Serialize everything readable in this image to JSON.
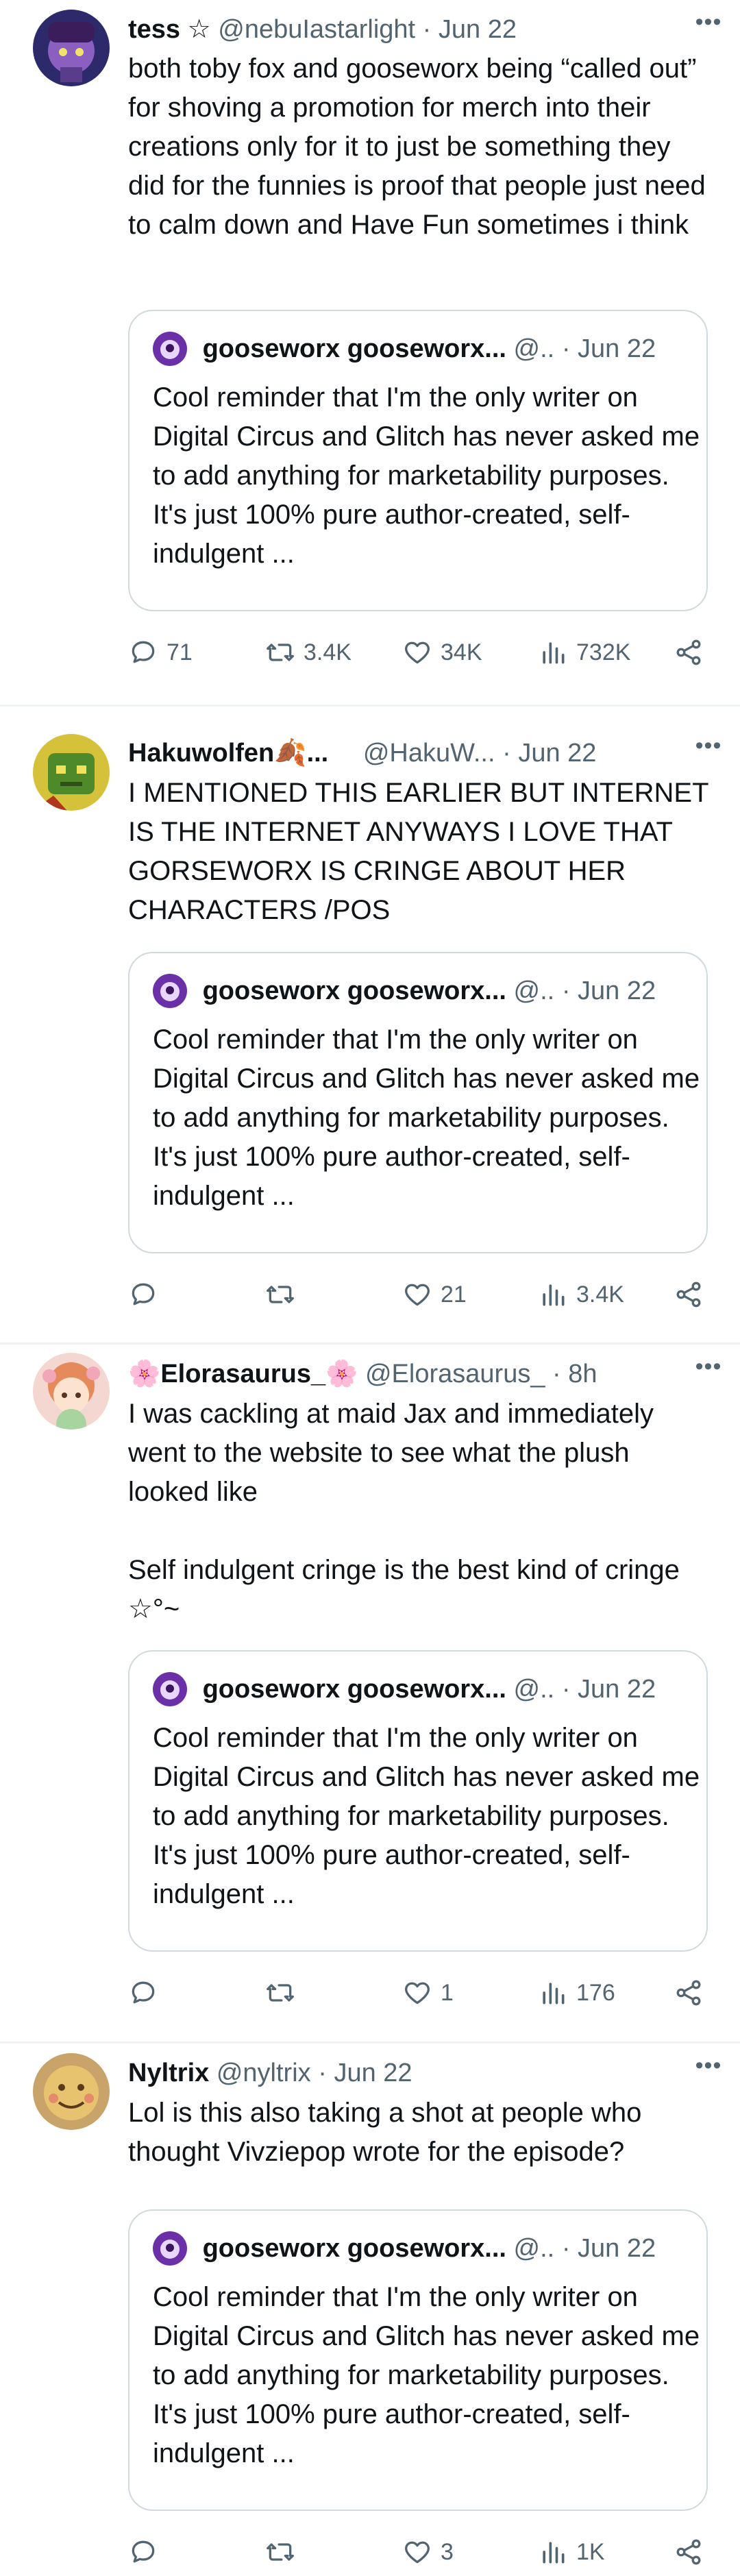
{
  "tweets": [
    {
      "name": "tess ☆",
      "handle": "@nebuIastarlight",
      "dot": "·",
      "time": "Jun 22",
      "more": "•••",
      "text": "both toby fox and gooseworx being “called out” for shoving a promotion for merch into their creations only for it to just be something they did for the funnies is proof that people just need to calm down and Have Fun sometimes i think",
      "quote": {
        "name": "gooseworx gooseworx...",
        "handle": "@..",
        "dot": "·",
        "time": "Jun 22",
        "text": "Cool reminder that I'm the only writer on Digital Circus and Glitch has never asked me to add anything for marketability purposes. It's just 100% pure author-created, self-indulgent ..."
      },
      "replies": "71",
      "retweets": "3.4K",
      "likes": "34K",
      "views": "732K"
    },
    {
      "name": "Hakuwolfen🍂...",
      "handle": "@HakuW...",
      "dot": "·",
      "time": "Jun 22",
      "more": "•••",
      "text": "I MENTIONED THIS EARLIER BUT INTERNET IS THE INTERNET ANYWAYS I LOVE THAT GORSEWORX IS CRINGE ABOUT HER CHARACTERS /POS",
      "quote": {
        "name": "gooseworx gooseworx...",
        "handle": "@..",
        "dot": "·",
        "time": "Jun 22",
        "text": "Cool reminder that I'm the only writer on Digital Circus and Glitch has never asked me to add anything for marketability purposes. It's just 100% pure author-created, self-indulgent ..."
      },
      "replies": "",
      "retweets": "",
      "likes": "21",
      "views": "3.4K"
    },
    {
      "name": "🌸Elorasaurus_🌸",
      "handle": "@Elorasaurus_",
      "dot": "·",
      "time": "8h",
      "more": "•••",
      "text": "I was cackling at maid Jax and immediately went to the website to see what the plush looked like\n\nSelf indulgent cringe is the best kind of cringe ☆°~",
      "quote": {
        "name": "gooseworx gooseworx...",
        "handle": "@..",
        "dot": "·",
        "time": "Jun 22",
        "text": "Cool reminder that I'm the only writer on Digital Circus and Glitch has never asked me to add anything for marketability purposes. It's just 100% pure author-created, self-indulgent ..."
      },
      "replies": "",
      "retweets": "",
      "likes": "1",
      "views": "176"
    },
    {
      "name": "Nyltrix",
      "handle": "@nyltrix",
      "dot": "·",
      "time": "Jun 22",
      "more": "•••",
      "text": "Lol is this also taking a shot at people who thought Vivziepop wrote for the episode?",
      "quote": {
        "name": "gooseworx gooseworx...",
        "handle": "@..",
        "dot": "·",
        "time": "Jun 22",
        "text": "Cool reminder that I'm the only writer on Digital Circus and Glitch has never asked me to add anything for marketability purposes. It's just 100% pure author-created, self-indulgent ..."
      },
      "replies": "",
      "retweets": "",
      "likes": "3",
      "views": "1K"
    }
  ],
  "icons": [
    "reply-icon",
    "retweet-icon",
    "like-icon",
    "views-icon",
    "share-icon",
    "more-icon"
  ],
  "colors": {
    "text": "#0f1419",
    "muted": "#536471",
    "border": "#cfd9de",
    "separator": "#eff3f4"
  }
}
